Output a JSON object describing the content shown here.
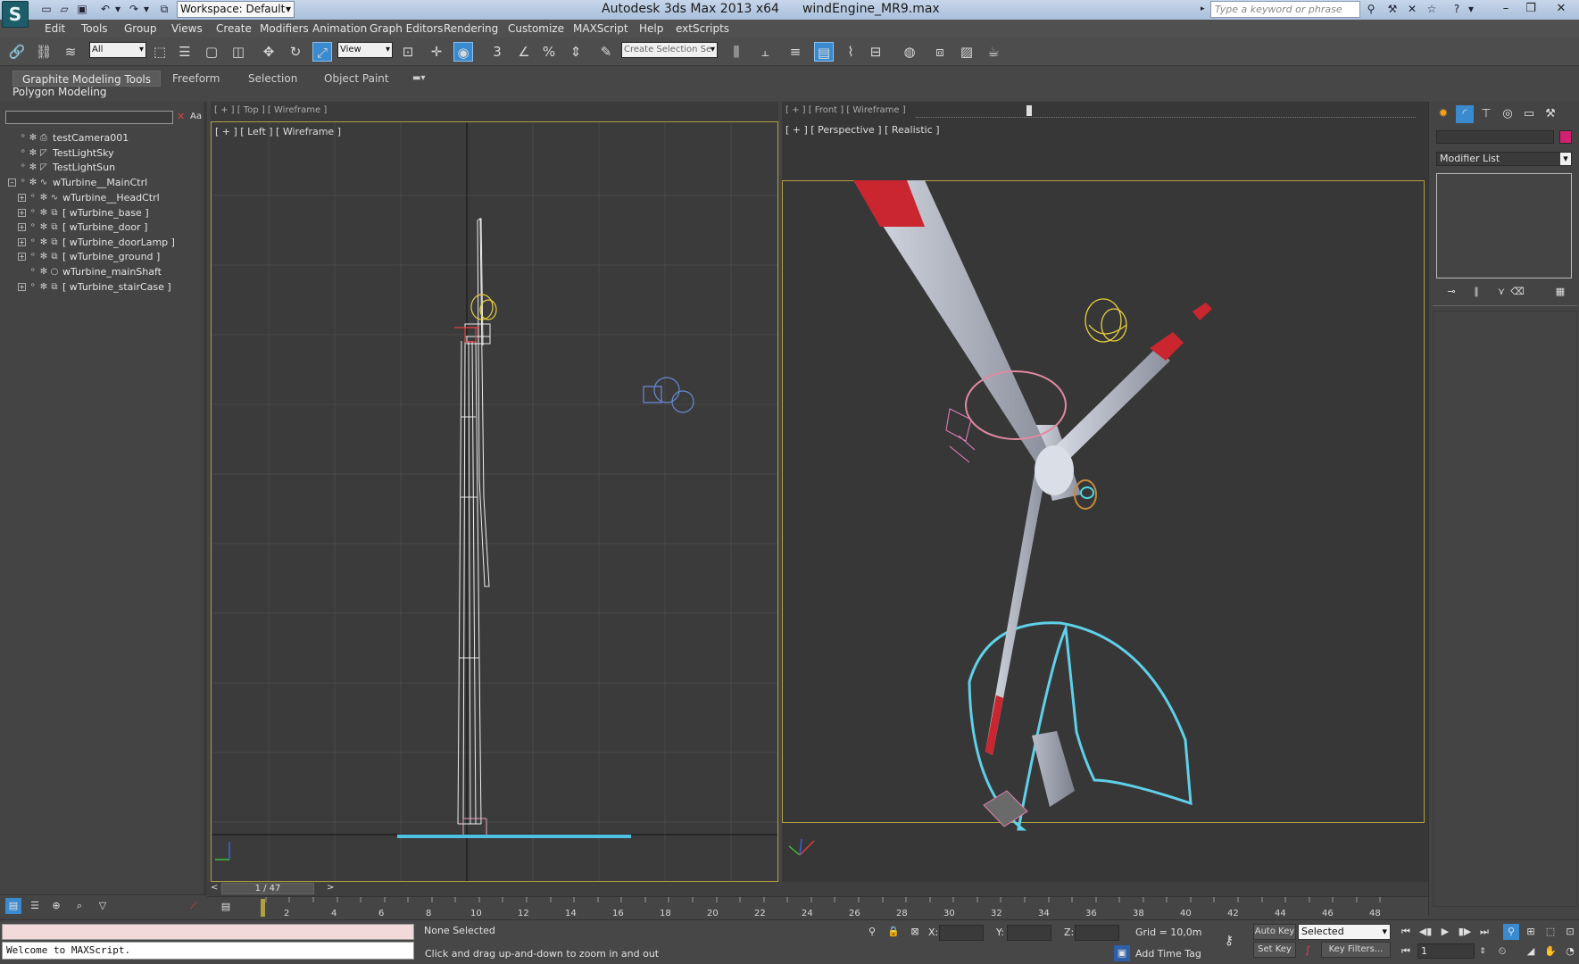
{
  "title_bar": {
    "app_name": "Autodesk 3ds Max  2013 x64",
    "file_name": "windEngine_MR9.max",
    "workspace": "Workspace: Default",
    "search_placeholder": "Type a keyword or phrase"
  },
  "menu": [
    "Edit",
    "Tools",
    "Group",
    "Views",
    "Create",
    "Modifiers",
    "Animation",
    "Graph Editors",
    "Rendering",
    "Customize",
    "MAXScript",
    "Help",
    "extScripts"
  ],
  "toolbar": {
    "filter_value": "All",
    "ref_coord_value": "View",
    "named_selection_placeholder": "Create Selection Se",
    "snap_labels": [
      "3",
      "%"
    ]
  },
  "ribbon": {
    "tabs": [
      "Graphite Modeling Tools",
      "Freeform",
      "Selection",
      "Object Paint"
    ],
    "panel": "Polygon Modeling"
  },
  "explorer": {
    "filter_label": "Aa",
    "items": [
      {
        "label": "testCamera001"
      },
      {
        "label": "TestLightSky"
      },
      {
        "label": "TestLightSun"
      },
      {
        "label": "wTurbine__MainCtrl"
      },
      {
        "label": "wTurbine__HeadCtrl"
      },
      {
        "label": "[ wTurbine_base ]"
      },
      {
        "label": "[ wTurbine_door ]"
      },
      {
        "label": "[ wTurbine_doorLamp ]"
      },
      {
        "label": "[ wTurbine_ground ]"
      },
      {
        "label": "wTurbine_mainShaft"
      },
      {
        "label": "[ wTurbine_stairCase ]"
      }
    ]
  },
  "viewports": {
    "top_ghost": "[ + ] [ Top ] [ Wireframe ]",
    "front_ghost": "[ + ] [ Front ] [ Wireframe ]",
    "left": "[ + ] [ Left ] [ Wireframe ]",
    "perspective": "[ + ] [ Perspective ] [ Realistic ]"
  },
  "command_panel": {
    "modifier_list": "Modifier List",
    "accent_color": "#d0206f"
  },
  "time": {
    "frame_display": "1 / 47",
    "prev": "<",
    "next": ">",
    "ticks": [
      "2",
      "4",
      "6",
      "8",
      "10",
      "12",
      "14",
      "16",
      "18",
      "20",
      "22",
      "24",
      "26",
      "28",
      "30",
      "32",
      "34",
      "36",
      "38",
      "40",
      "42",
      "44",
      "46",
      "48"
    ]
  },
  "status": {
    "maxscript_welcome": "Welcome to MAXScript.",
    "selection_status": "None Selected",
    "prompt": "Click and drag up-and-down to zoom in and out",
    "x_label": "X:",
    "y_label": "Y:",
    "z_label": "Z:",
    "grid": "Grid = 10,0m",
    "add_time_tag": "Add Time Tag",
    "auto_key": "Auto Key",
    "set_key": "Set Key",
    "key_mode": "Selected",
    "key_filters": "Key Filters...",
    "current_frame": "1"
  }
}
